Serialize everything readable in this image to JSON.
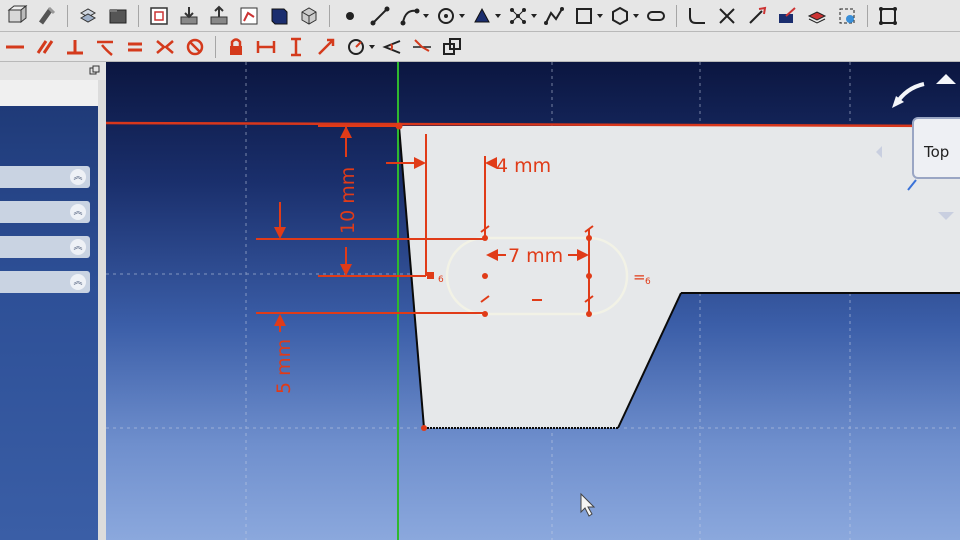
{
  "toolbar1": {
    "icons": [
      "part-icon",
      "workbench-icon",
      "std-tool-icon",
      "view-group-icon",
      "folder-icon",
      "new-sketch-icon",
      "leave-sketch-icon",
      "export-icon",
      "view-sketch-icon",
      "view-section-icon",
      "box-icon",
      "point-icon",
      "line-icon",
      "arc-icon",
      "circle-icon",
      "conic-icon",
      "bspline-icon",
      "polyline-icon",
      "rectangle-icon",
      "polygon-icon",
      "slot-icon",
      "fillet-icon",
      "trim-icon",
      "extend-icon",
      "external-geometry-icon",
      "carbon-copy-icon",
      "construction-icon",
      "array-icon"
    ]
  },
  "toolbar2": {
    "icons": [
      "horizontal-icon",
      "parallel-icon",
      "perpendicular-icon",
      "tangent-icon",
      "equal-icon",
      "symmetric-icon",
      "block-icon",
      "lock-icon",
      "horizontal-distance-icon",
      "vertical-distance-icon",
      "distance-icon",
      "radius-icon",
      "angle-icon",
      "snell-icon",
      "internal-alignment-icon"
    ]
  },
  "left_panel": {
    "sections": [
      "section-1",
      "section-2",
      "section-3",
      "section-4"
    ]
  },
  "viewport": {
    "dimensions": {
      "d_4mm": "4 mm",
      "d_7mm": "7 mm",
      "d_10mm": "10 mm",
      "d_5mm": "5 mm"
    },
    "constraint_subscript_a": "6",
    "constraint_subscript_b": "6",
    "equal_symbol": "=",
    "navcube_face": "Top",
    "colors": {
      "constraint": "#e03b18",
      "sketch_line": "#000000",
      "slot_line": "#f2f2e6",
      "face_fill": "#e6e8ea",
      "y_axis": "#2fb82f",
      "x_axis": "#d8371c"
    }
  }
}
